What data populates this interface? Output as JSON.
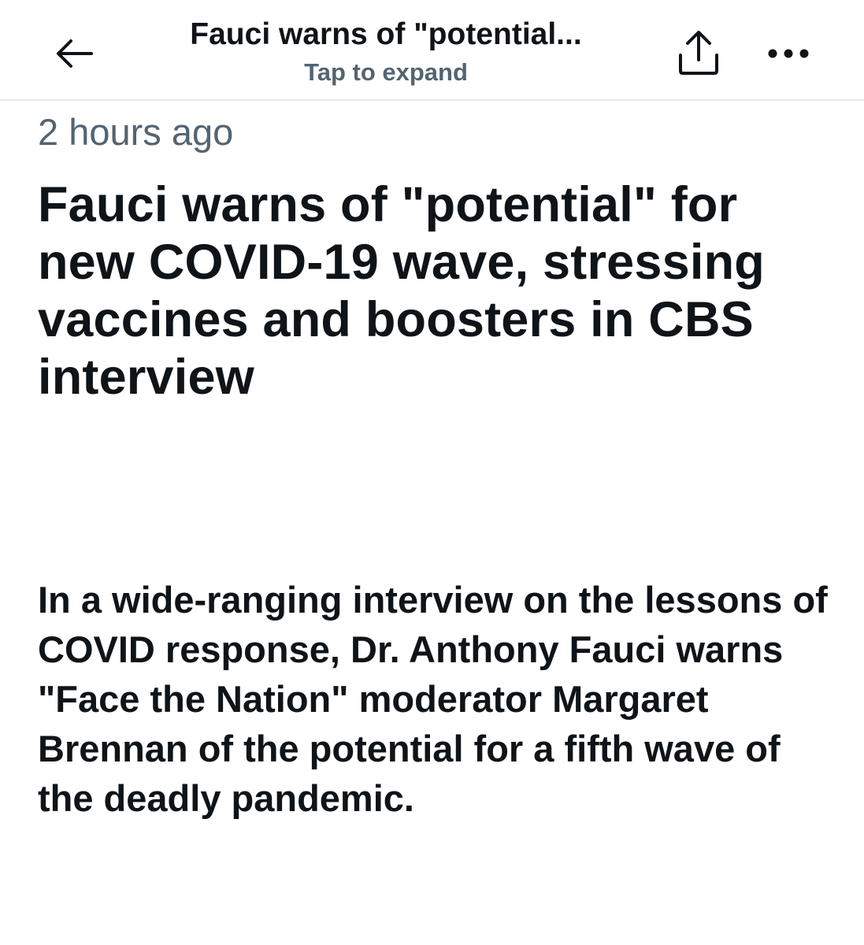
{
  "header": {
    "title": "Fauci warns of \"potential...",
    "subtitle": "Tap to expand",
    "back_icon": "arrow-left-icon",
    "share_icon": "share-upload-icon",
    "more_icon": "more-horizontal-icon"
  },
  "article": {
    "timestamp": "2 hours ago",
    "headline": "Fauci warns of \"potential\" for new COVID-19 wave, stressing vaccines and boosters in CBS interview",
    "summary": "In a wide-ranging interview on the lessons of COVID response, Dr. Anthony Fauci warns \"Face the Nation\" moderator Margaret Brennan of the potential for a fifth wave of the deadly pandemic."
  },
  "colors": {
    "text_primary": "#0f1419",
    "text_secondary": "#536471",
    "divider": "#e6e9eb"
  }
}
